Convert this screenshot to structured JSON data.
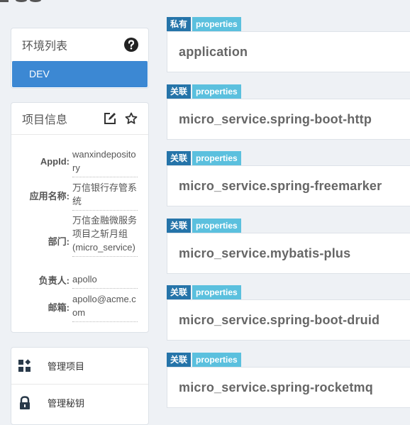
{
  "env_list": {
    "title": "环境列表",
    "help_icon": "question-circle-icon",
    "envs": [
      {
        "label": "DEV",
        "active": true
      }
    ]
  },
  "project_info": {
    "title": "项目信息",
    "edit_icon": "edit-icon",
    "star_icon": "star-icon",
    "fields": [
      {
        "label": "AppId:",
        "value": "wanxindepository"
      },
      {
        "label": "应用名称:",
        "value": "万信银行存管系统"
      },
      {
        "label": "部门:",
        "value": "万信金融微服务项目之斩月组(micro_service)"
      },
      {
        "label": "负责人:",
        "value": "apollo"
      },
      {
        "label": "邮箱:",
        "value": "apollo@acme.com"
      }
    ]
  },
  "menu": [
    {
      "label": "管理项目",
      "icon": "widgets-icon"
    },
    {
      "label": "管理秘钥",
      "icon": "lock-icon"
    }
  ],
  "namespaces": [
    {
      "type": "私有",
      "format": "properties",
      "name": "application"
    },
    {
      "type": "关联",
      "format": "properties",
      "name": "micro_service.spring-boot-http"
    },
    {
      "type": "关联",
      "format": "properties",
      "name": "micro_service.spring-freemarker"
    },
    {
      "type": "关联",
      "format": "properties",
      "name": "micro_service.mybatis-plus"
    },
    {
      "type": "关联",
      "format": "properties",
      "name": "micro_service.spring-boot-druid"
    },
    {
      "type": "关联",
      "format": "properties",
      "name": "micro_service.spring-rocketmq"
    }
  ],
  "colors": {
    "tag_type": "#2574a9",
    "tag_format": "#5bc0de",
    "env_active": "#3c88d3"
  }
}
